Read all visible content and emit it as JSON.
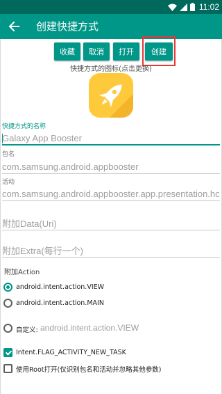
{
  "status_bar": {
    "time": "11:02"
  },
  "app_bar": {
    "title": "创建快捷方式"
  },
  "buttons": {
    "favorite": "收藏",
    "cancel": "取消",
    "open": "打开",
    "create": "创建"
  },
  "icon_caption": "快捷方式的图标(点击更换)",
  "fields": {
    "name": {
      "label": "快捷方式的名称",
      "value": "Galaxy App Booster"
    },
    "package": {
      "label": "包名",
      "value": "com.samsung.android.appbooster"
    },
    "activity": {
      "label": "活动",
      "value": "com.samsung.android.appbooster.app.presentation.hc"
    },
    "data_uri": {
      "placeholder": "附加Data(Uri)"
    },
    "extra": {
      "placeholder": "附加Extra(每行一个)"
    }
  },
  "action": {
    "label": "附加Action",
    "options": [
      "android.intent.action.VIEW",
      "android.intent.action.MAIN"
    ],
    "custom_label": "自定义:",
    "custom_placeholder": "android.intent.action.VIEW",
    "selected": "android.intent.action.VIEW"
  },
  "flags": {
    "new_task": "Intent.FLAG_ACTIVITY_NEW_TASK",
    "root_open": "使用Root打开(仅识别包名和活动并忽略其他参数)"
  },
  "colors": {
    "primary": "#009688",
    "primary_dark": "#00695c",
    "highlight": "#e53935",
    "icon_bg": "#ffc93c"
  },
  "icons": [
    "wifi-icon",
    "signal-icon",
    "battery-icon",
    "back-arrow-icon",
    "rocket-icon"
  ]
}
